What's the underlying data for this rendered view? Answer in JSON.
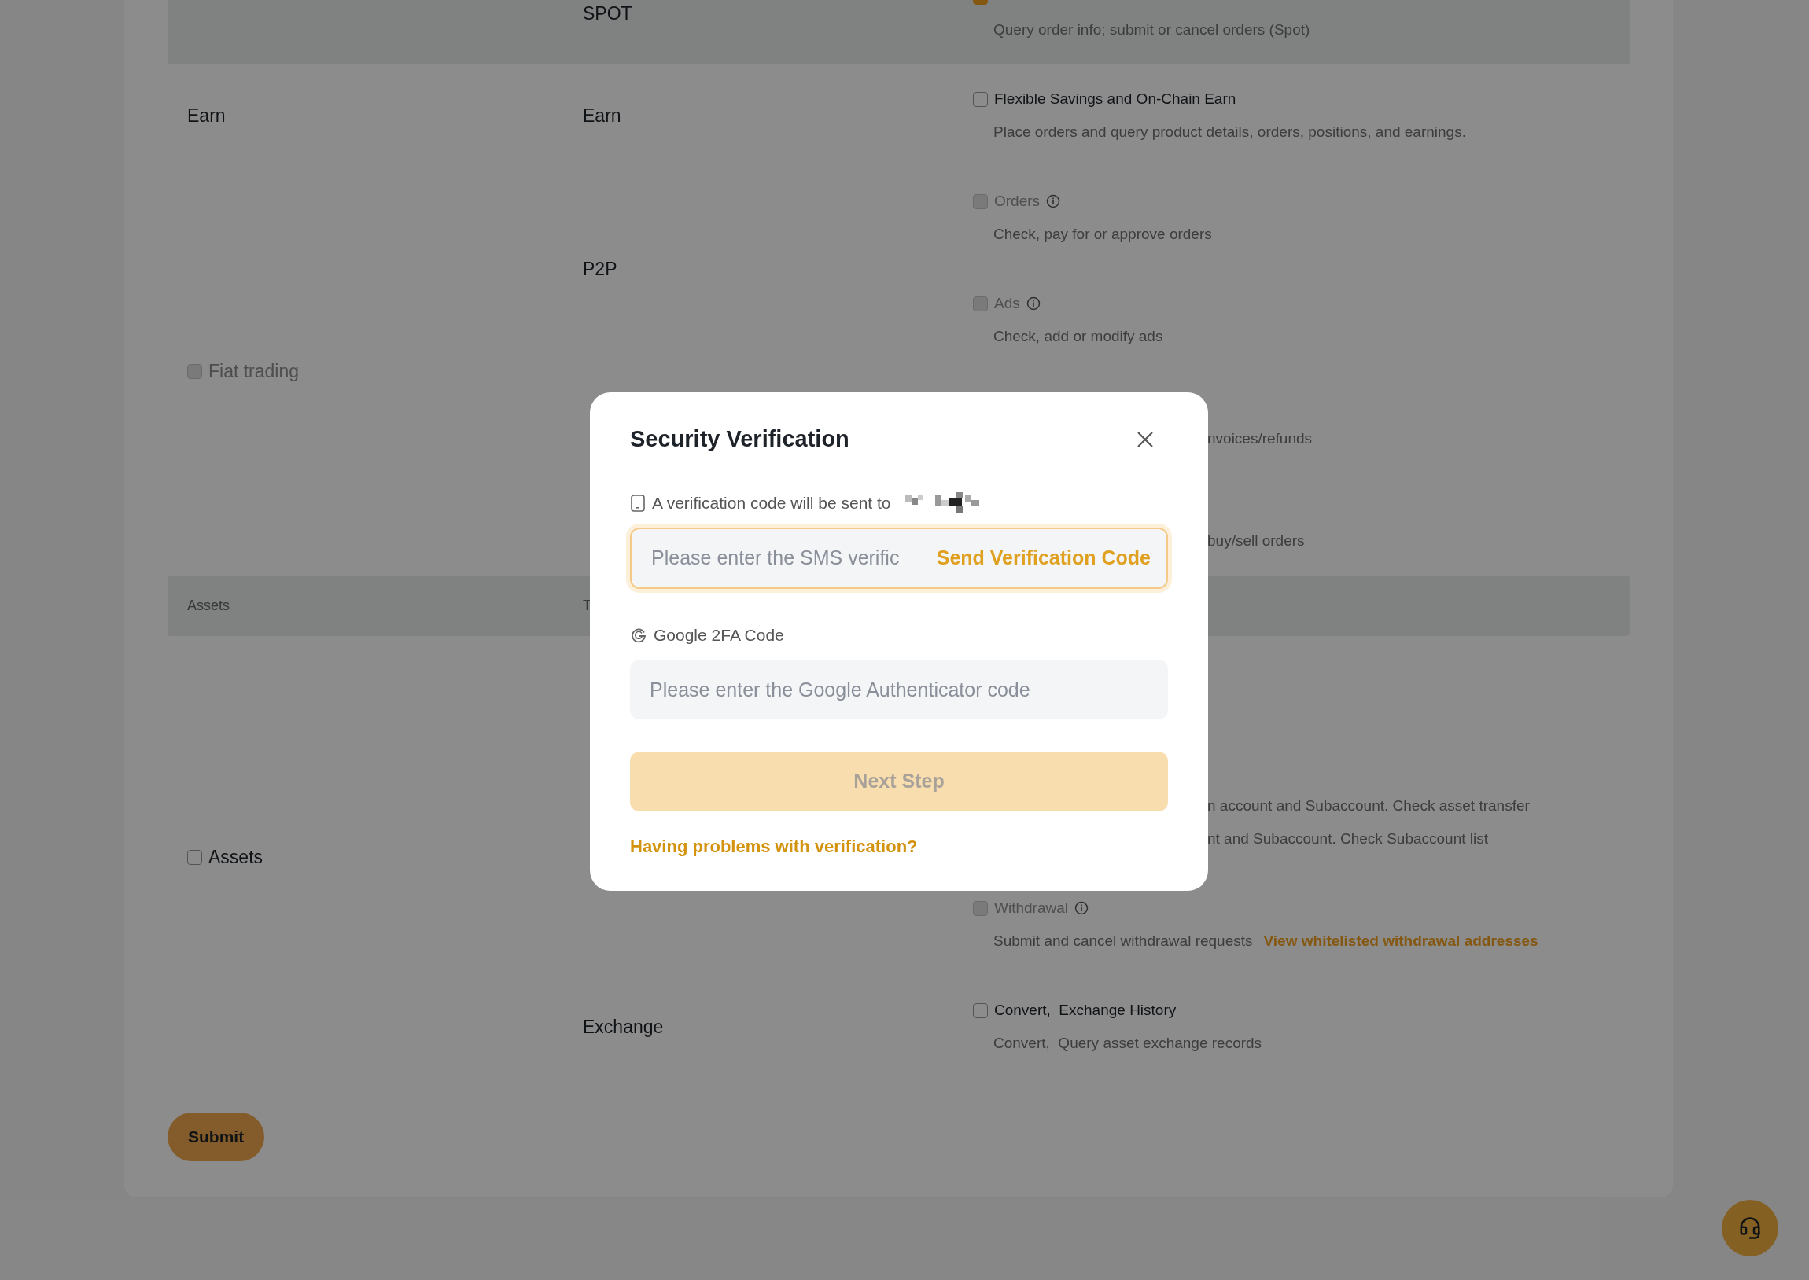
{
  "permissions": {
    "rows": [
      {
        "kind": "group",
        "shaded": true,
        "products": [
          {
            "name": "SPOT",
            "permissions": [
              {
                "kind": "checkbox",
                "checked": true,
                "description": "Query order info; submit or cancel orders (Spot)"
              }
            ]
          }
        ]
      },
      {
        "kind": "group",
        "category": {
          "label": "Earn"
        },
        "products": [
          {
            "name": "Earn",
            "permissions": [
              {
                "kind": "checkbox",
                "checked": false,
                "disabled": false,
                "label": "Flexible Savings and On-Chain Earn",
                "description": "Place orders and query product details, orders, positions, and earnings."
              }
            ]
          }
        ]
      },
      {
        "kind": "group",
        "category": {
          "label": "Fiat trading",
          "checked": false,
          "disabled": true
        },
        "products": [
          {
            "name": "P2P",
            "permissions": [
              {
                "kind": "checkbox",
                "checked": false,
                "disabled": true,
                "label": "Orders",
                "info": true,
                "description": "Check, pay for or approve orders"
              },
              {
                "kind": "checkbox",
                "checked": false,
                "disabled": true,
                "label": "Ads",
                "info": true,
                "description": "Check, add or modify ads"
              }
            ]
          },
          {
            "permissions": [
              {
                "kind": "fragment",
                "lines": [
                  "nvoices/refunds"
                ]
              }
            ]
          },
          {
            "permissions": [
              {
                "kind": "fragment",
                "lines": [
                  "buy/sell orders"
                ]
              }
            ]
          }
        ]
      },
      {
        "kind": "header",
        "columns": [
          "Assets",
          "T"
        ]
      },
      {
        "kind": "group",
        "category": {
          "label": "Assets",
          "checked": false,
          "disabled": false
        },
        "products": [
          {
            "permissions": [
              {
                "kind": "covered"
              },
              {
                "kind": "fragment",
                "lines": [
                  "n account and Subaccount. Check asset transfer",
                  "nt and Subaccount. Check Subaccount list"
                ]
              },
              {
                "kind": "checkbox",
                "checked": false,
                "disabled": true,
                "label": "Withdrawal",
                "info": true,
                "description": "Submit and cancel withdrawal requests",
                "link": "View whitelisted withdrawal addresses"
              }
            ]
          },
          {
            "name": "Exchange",
            "permissions": [
              {
                "kind": "checkbox",
                "checked": false,
                "disabled": false,
                "label": "Convert,  Exchange History",
                "description": "Convert,  Query asset exchange records"
              }
            ]
          }
        ]
      }
    ]
  },
  "submit": "Submit",
  "dialog": {
    "title": "Security Verification",
    "sms": {
      "label": "A verification code will be sent to",
      "placeholder": "Please enter the SMS verific",
      "action": "Send Verification Code",
      "focused": true
    },
    "google": {
      "label": "Google 2FA Code",
      "placeholder": "Please enter the Google Authenticator code"
    },
    "next": {
      "label": "Next Step",
      "disabled": true
    },
    "help_link": "Having problems with verification?"
  }
}
